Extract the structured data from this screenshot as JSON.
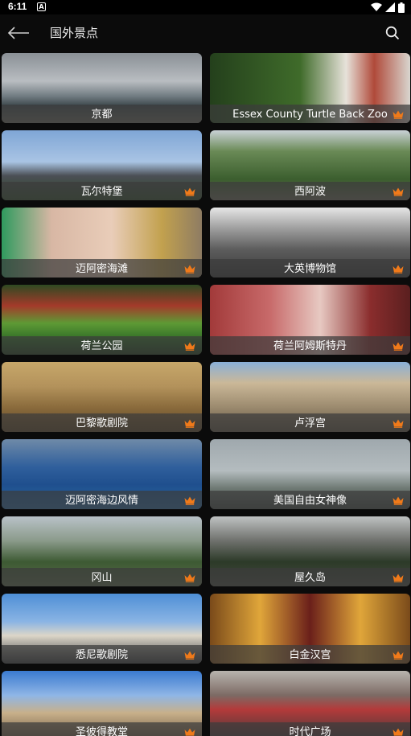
{
  "status_bar": {
    "time": "6:11",
    "notification_letter": "A"
  },
  "header": {
    "title": "国外景点"
  },
  "colors": {
    "crown": "#f07a1a",
    "background": "#0b0b0b"
  },
  "places": [
    {
      "name": "京都",
      "premium": false,
      "thumb": "kyoto"
    },
    {
      "name": "Essex County Turtle Back Zoo",
      "premium": true,
      "thumb": "zoo"
    },
    {
      "name": "瓦尔特堡",
      "premium": true,
      "thumb": "castle"
    },
    {
      "name": "西阿波",
      "premium": true,
      "thumb": "valley"
    },
    {
      "name": "迈阿密海滩",
      "premium": true,
      "thumb": "beach"
    },
    {
      "name": "大英博物馆",
      "premium": true,
      "thumb": "museum"
    },
    {
      "name": "荷兰公园",
      "premium": true,
      "thumb": "garden"
    },
    {
      "name": "荷兰阿姆斯特丹",
      "premium": true,
      "thumb": "amsterdam"
    },
    {
      "name": "巴黎歌剧院",
      "premium": true,
      "thumb": "opera"
    },
    {
      "name": "卢浮宫",
      "premium": true,
      "thumb": "louvre"
    },
    {
      "name": "迈阿密海边风情",
      "premium": true,
      "thumb": "harbor"
    },
    {
      "name": "美国自由女神像",
      "premium": true,
      "thumb": "liberty"
    },
    {
      "name": "冈山",
      "premium": true,
      "thumb": "okayama"
    },
    {
      "name": "屋久岛",
      "premium": true,
      "thumb": "yakushima"
    },
    {
      "name": "悉尼歌剧院",
      "premium": true,
      "thumb": "sydney"
    },
    {
      "name": "白金汉宫",
      "premium": true,
      "thumb": "buckingham"
    },
    {
      "name": "圣彼得教堂",
      "premium": true,
      "thumb": "stpeter"
    },
    {
      "name": "时代广场",
      "premium": true,
      "thumb": "timessquare"
    }
  ]
}
